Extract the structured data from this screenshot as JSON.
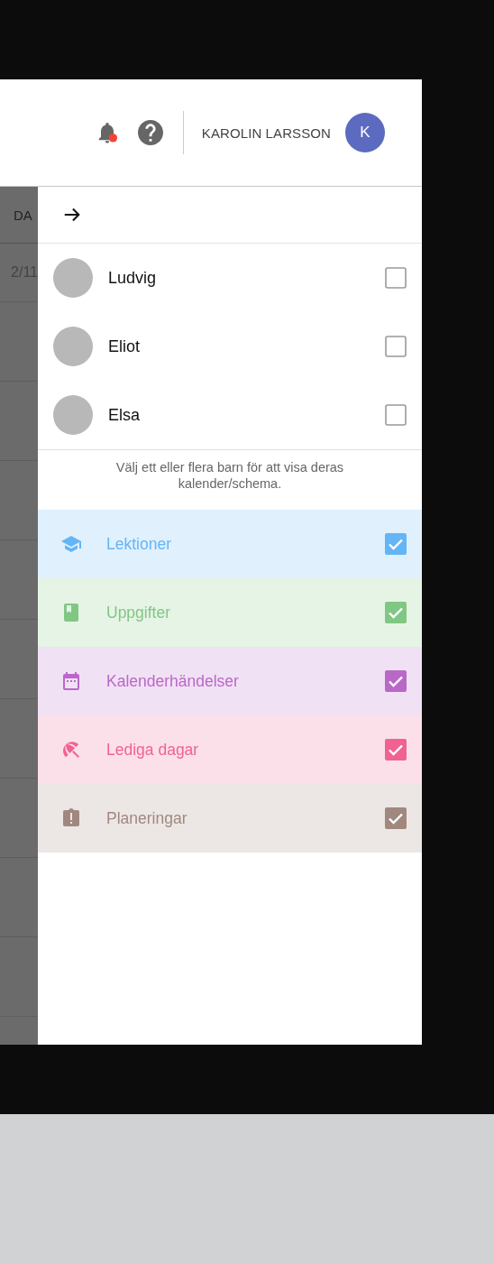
{
  "header": {
    "notifications": {
      "unread": true
    },
    "user_name": "KAROLIN LARSSON",
    "avatar_initial": "K"
  },
  "background_calendar": {
    "column_header": "DA",
    "date": "2/11"
  },
  "panel": {
    "children": [
      {
        "name": "Ludvig",
        "checked": false
      },
      {
        "name": "Eliot",
        "checked": false
      },
      {
        "name": "Elsa",
        "checked": false
      }
    ],
    "hint": "Välj ett eller flera barn för att visa deras kalender/schema.",
    "categories": [
      {
        "kind": "lessons",
        "label": "Lektioner",
        "color": "#64b5f6",
        "checked": true
      },
      {
        "kind": "assignments",
        "label": "Uppgifter",
        "color": "#81c784",
        "checked": true
      },
      {
        "kind": "events",
        "label": "Kalenderhändelser",
        "color": "#ba68c8",
        "checked": true
      },
      {
        "kind": "holidays",
        "label": "Lediga dagar",
        "color": "#f06292",
        "checked": true
      },
      {
        "kind": "plans",
        "label": "Planeringar",
        "color": "#a1887f",
        "checked": true
      }
    ]
  }
}
